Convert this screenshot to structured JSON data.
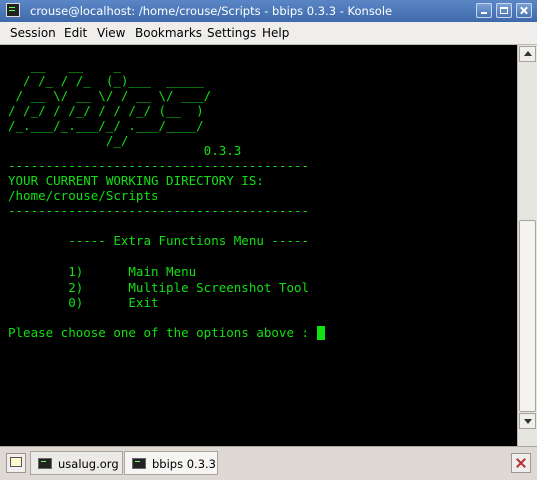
{
  "window": {
    "title": "crouse@localhost: /home/crouse/Scripts - bbips 0.3.3 - Konsole"
  },
  "menubar": {
    "items": [
      "Session",
      "Edit",
      "View",
      "Bookmarks",
      "Settings",
      "Help"
    ]
  },
  "terminal": {
    "lines": [
      "   __   __    _",
      "  / /_ / /_  (_)___  _____",
      " / __ \\/ __ \\/ / __ \\/ ___/",
      "/ /_/ / /_/ / / /_/ (__  )",
      "/_.___/_.___/_/ .___/____/",
      "             /_/",
      "                          0.3.3",
      "----------------------------------------",
      "YOUR CURRENT WORKING DIRECTORY IS:",
      "/home/crouse/Scripts",
      "----------------------------------------",
      "",
      "        ----- Extra Functions Menu -----",
      "",
      "        1)      Main Menu",
      "        2)      Multiple Screenshot Tool",
      "        0)      Exit",
      "",
      "Please choose one of the options above : "
    ],
    "colors": {
      "background": "#000000",
      "foreground": "#11e011"
    }
  },
  "tabs": [
    {
      "label": "usalug.org"
    },
    {
      "label": "bbips 0.3.3"
    }
  ],
  "icons": {
    "app": "terminal-icon",
    "minimize": "minimize-icon",
    "maximize": "maximize-icon",
    "close": "close-icon",
    "new_tab": "new-session-icon",
    "close_tab": "close-session-icon"
  }
}
